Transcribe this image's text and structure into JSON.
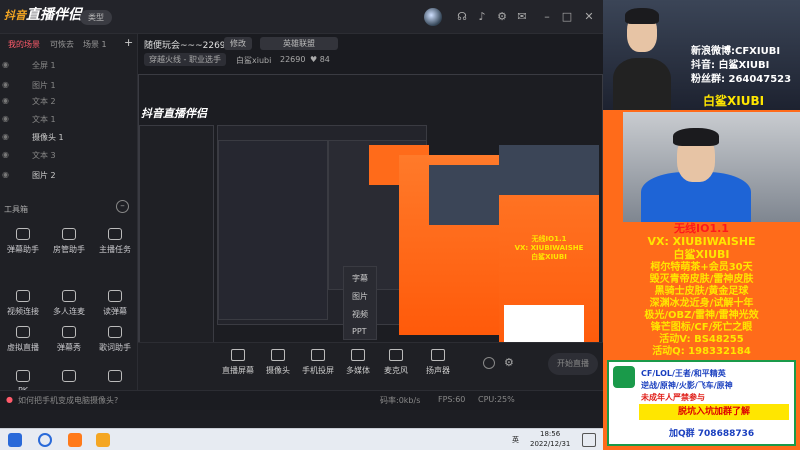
{
  "app": {
    "logo_text": "直播伴侣",
    "type_badge": "类型",
    "room_title": "随便玩会~~~22690",
    "edit_label": "修改",
    "game_tag": "英雄联盟",
    "sub_title": "穿越火线 - 职业选手",
    "username": "白鲨xiubi",
    "room_id": "22690",
    "fans": "84"
  },
  "scenes": {
    "tabs": [
      "我的场景",
      "可恢去",
      "场景 1"
    ],
    "add_label": "+",
    "items": [
      "全屏 1",
      "图片 1",
      "文本 2",
      "文本 1",
      "摄像头 1",
      "文本 3",
      "图片 2"
    ]
  },
  "tools": {
    "title": "工具箱",
    "items": [
      "弹幕助手",
      "房管助手",
      "主播任务",
      "视频连接",
      "多人连麦",
      "读弹幕",
      "虚拟直播",
      "弹幕秀",
      "歌词助手",
      "PK",
      "",
      ""
    ]
  },
  "bottom_controls": [
    "直播屏幕",
    "摄像头",
    "手机投屏",
    "多媒体",
    "麦克风",
    "扬声器"
  ],
  "start_label": "开始直播",
  "status": {
    "tip": "如何把手机变成电脑摄像头?",
    "bitrate": "码率:0kb/s",
    "fps": "FPS:60",
    "cpu": "CPU:25%"
  },
  "context_menu": [
    "字幕",
    "图片",
    "视频",
    "PPT"
  ],
  "taskbar": {
    "time": "18:56",
    "date": "2022/12/31",
    "lang": "英"
  },
  "overlay": {
    "weibo": "新浪微博:CFXIUBI",
    "douyin": "抖音: 白鲨XIUBI",
    "fans_count": "粉丝群: 264047523",
    "name_tag": "白鲨XIUBI",
    "promo_lines": [
      "无线IO1.1",
      "VX: XIUBIWAISHE",
      "白鲨XIUBI",
      "柯尔特萌茶+会员30天",
      "毁灭青帝皮肤/雷神皮肤",
      "黑骑士皮肤/黄金足球",
      "深渊冰龙近身/试解十年",
      "极光/OBZ/雷神/雷神光效",
      "锋芒图标/CF/死亡之眼",
      "活动V: BS48255",
      "活动Q: 198332184"
    ],
    "ad_lines": [
      "CF/LOL/王者/和平精英",
      "逆战/原神/火影/飞车/原神",
      "未成年人严禁参与",
      "脱坑入坑加群了解",
      "加Q群 708688736"
    ]
  },
  "colors": {
    "accent": "#ff5b6b",
    "overlay_bg": "#ff6b1a",
    "promo_yellow": "#ffe600",
    "promo_red": "#ff1a1a"
  }
}
